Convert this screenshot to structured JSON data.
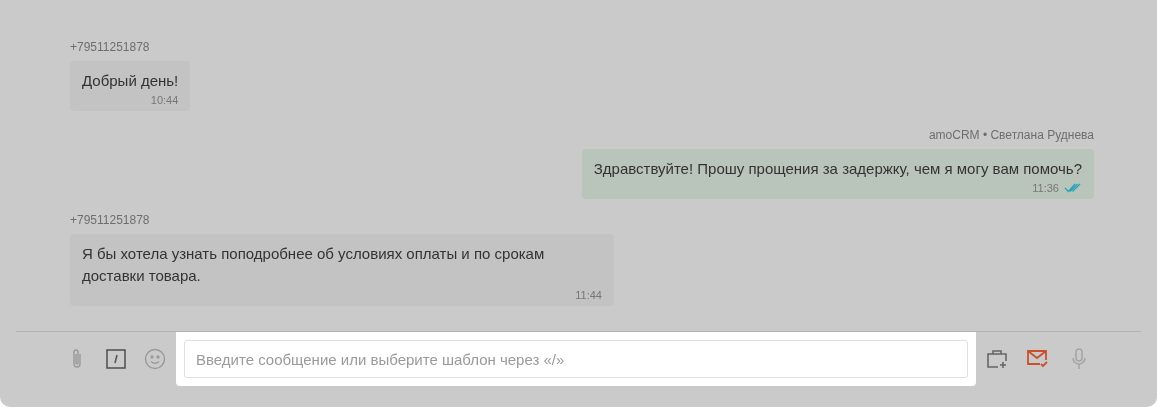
{
  "messages": [
    {
      "kind": "incoming",
      "sender": "+79511251878",
      "text": "Добрый день!",
      "time": "10:44"
    },
    {
      "kind": "outgoing",
      "sender": "amoCRM • Светлана Руднева",
      "text": "Здравствуйте! Прошу прощения за задержку, чем я могу вам помочь?",
      "time": "11:36",
      "read": true
    },
    {
      "kind": "incoming",
      "sender": "+79511251878",
      "text": "Я бы хотела узнать поподробнее об условиях оплаты и по срокам доставки товара.",
      "time": "11:44"
    }
  ],
  "composer": {
    "placeholder": "Введите сообщение или выберите шаблон через «/»"
  }
}
